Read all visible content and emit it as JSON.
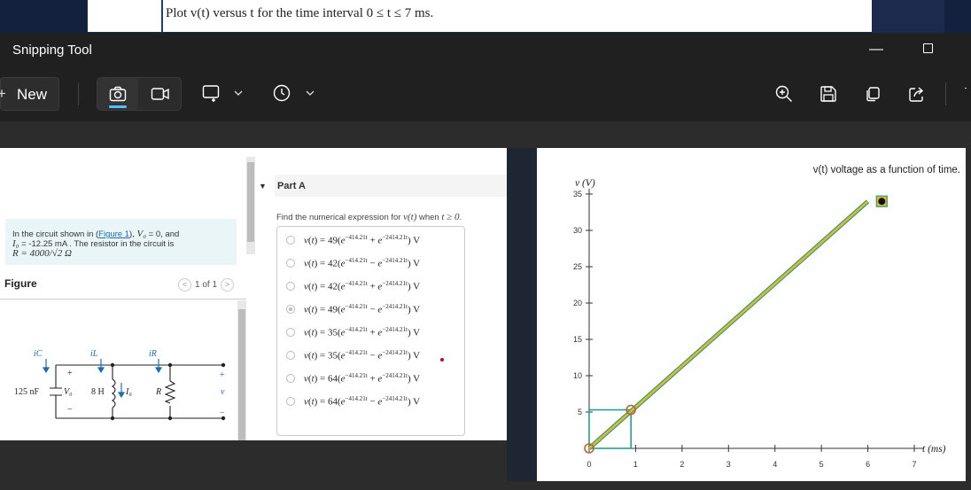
{
  "background_page": {
    "question_text": "Plot v(t) versus t for the time interval 0 ≤ t ≤ 7 ms."
  },
  "window": {
    "title": "Snipping Tool",
    "minimize_glyph": "—"
  },
  "toolbar": {
    "new_label": "New",
    "new_plus": "+",
    "snip_mode_selected": "screenshot"
  },
  "problem": {
    "intro": "In the circuit shown in (",
    "link": "Figure 1",
    "after_link": "), ",
    "v0": "V₀",
    "v0_val": " = 0, and",
    "i0": "I₀",
    "i0_val": " = -12.25 mA . The resistor in the circuit is",
    "r": "R = 4000/√2 Ω"
  },
  "figure": {
    "label": "Figure",
    "pager": "1 of 1",
    "prev": "<",
    "next": ">",
    "circuit": {
      "cap_label": "125 nF",
      "ind_label": "8 H",
      "res_label": "R",
      "v0_label": "V₀",
      "i0_label": "I₀",
      "ic": "iC",
      "il": "iL",
      "ir": "iR",
      "v": "v",
      "plus": "+",
      "minus": "−"
    }
  },
  "part_a": {
    "title": "Part A",
    "instruction_pre": "Find the numerical expression for ",
    "instruction_math": "v(t)",
    "instruction_mid": " when ",
    "instruction_math2": "t ≥ 0",
    "instruction_post": ".",
    "options": [
      {
        "coef": "49",
        "op": "+",
        "selected": false
      },
      {
        "coef": "42",
        "op": "−",
        "selected": false
      },
      {
        "coef": "42",
        "op": "+",
        "selected": false
      },
      {
        "coef": "49",
        "op": "−",
        "selected": true
      },
      {
        "coef": "35",
        "op": "+",
        "selected": false
      },
      {
        "coef": "35",
        "op": "−",
        "selected": false
      },
      {
        "coef": "64",
        "op": "+",
        "selected": false
      },
      {
        "coef": "64",
        "op": "−",
        "selected": false
      }
    ],
    "exp1": "−414.21t",
    "exp2": "−2414.21t",
    "unit": "V"
  },
  "chart_data": {
    "type": "line",
    "title": "v(t) voltage as a function of time.",
    "xlabel": "t (ms)",
    "ylabel": "v (V)",
    "xlim": [
      0,
      7
    ],
    "ylim": [
      0,
      35
    ],
    "xticks": [
      0,
      1,
      2,
      3,
      4,
      5,
      6,
      7
    ],
    "yticks": [
      5,
      10,
      15,
      20,
      25,
      30,
      35
    ],
    "series": [
      {
        "values": [
          [
            0,
            0
          ],
          [
            6,
            34
          ]
        ],
        "color": "#e8b820"
      }
    ],
    "points": [
      [
        0,
        0
      ],
      [
        0.9,
        5.3
      ]
    ],
    "selection_box": [
      [
        0,
        0
      ],
      [
        0.9,
        5.3
      ]
    ],
    "marker": [
      6.3,
      34
    ],
    "line_color": "#e8b820",
    "line_edge_color": "#2a9d8f",
    "point_color": "#c0622b",
    "box_color": "#2a9d8f"
  }
}
